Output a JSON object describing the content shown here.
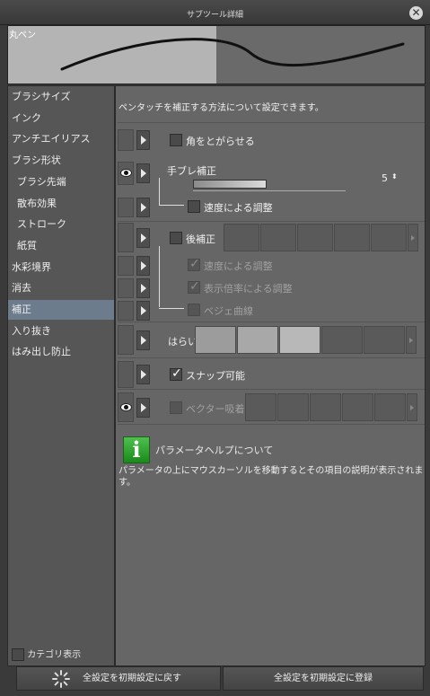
{
  "window": {
    "title": "サブツール詳細"
  },
  "preview": {
    "brush_name": "丸ペン"
  },
  "categories": [
    {
      "label": "ブラシサイズ",
      "sub": false,
      "selected": false
    },
    {
      "label": "インク",
      "sub": false,
      "selected": false
    },
    {
      "label": "アンチエイリアス",
      "sub": false,
      "selected": false
    },
    {
      "label": "ブラシ形状",
      "sub": false,
      "selected": false
    },
    {
      "label": "ブラシ先端",
      "sub": true,
      "selected": false
    },
    {
      "label": "散布効果",
      "sub": true,
      "selected": false
    },
    {
      "label": "ストローク",
      "sub": true,
      "selected": false
    },
    {
      "label": "紙質",
      "sub": true,
      "selected": false
    },
    {
      "label": "水彩境界",
      "sub": false,
      "selected": false
    },
    {
      "label": "消去",
      "sub": false,
      "selected": false
    },
    {
      "label": "補正",
      "sub": false,
      "selected": true
    },
    {
      "label": "入り抜き",
      "sub": false,
      "selected": false
    },
    {
      "label": "はみ出し防止",
      "sub": false,
      "selected": false
    }
  ],
  "category_display": {
    "label": "カテゴリ表示",
    "checked": false
  },
  "description": "ペンタッチを補正する方法について設定できます。",
  "settings": {
    "sharpen_corners": {
      "label": "角をとがらせる",
      "checked": false
    },
    "stabilization": {
      "label": "手ブレ補正",
      "value": "5",
      "level": 0.5
    },
    "speed_adjust": {
      "label": "速度による調整",
      "checked": false
    },
    "post_correction": {
      "label": "後補正",
      "checked": false
    },
    "post_speed_adjust": {
      "label": "速度による調整",
      "checked": true,
      "disabled": true
    },
    "post_zoom_adjust": {
      "label": "表示倍率による調整",
      "checked": true,
      "disabled": true
    },
    "bezier_curve": {
      "label": "ベジェ曲線",
      "checked": false,
      "disabled": true
    },
    "harai": {
      "label": "はらい",
      "selected_index": 2
    },
    "snap": {
      "label": "スナップ可能",
      "checked": true
    },
    "vector_snap": {
      "label": "ベクター吸着",
      "checked": false,
      "disabled": true
    }
  },
  "help": {
    "icon": "info-icon",
    "glyph": "i",
    "title": "パラメータヘルプについて",
    "text": "パラメータの上にマウスカーソルを移動するとその項目の説明が表示されます。"
  },
  "buttons": {
    "reset": "全設定を初期設定に戻す",
    "register": "全設定を初期設定に登録"
  },
  "colors": {
    "selected_category": "#6c7c8c",
    "help_icon": "#2fa02f"
  }
}
